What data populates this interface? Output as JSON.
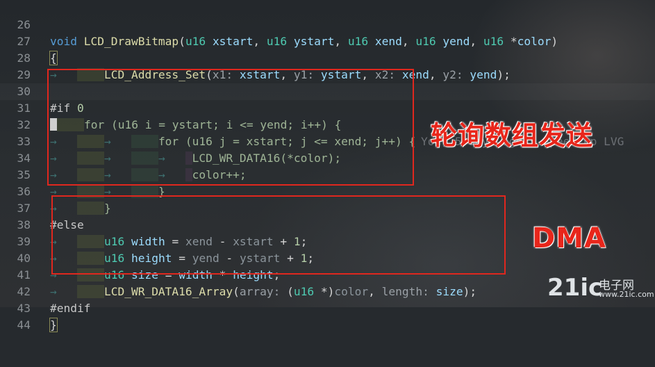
{
  "editor": {
    "lines": [
      {
        "n": "26"
      },
      {
        "n": "27"
      },
      {
        "n": "28"
      },
      {
        "n": "29"
      },
      {
        "n": "30"
      },
      {
        "n": "31"
      },
      {
        "n": "32"
      },
      {
        "n": "33"
      },
      {
        "n": "34"
      },
      {
        "n": "35"
      },
      {
        "n": "36"
      },
      {
        "n": "37"
      },
      {
        "n": "38"
      },
      {
        "n": "39"
      },
      {
        "n": "40"
      },
      {
        "n": "41"
      },
      {
        "n": "42"
      },
      {
        "n": "43"
      },
      {
        "n": "44"
      }
    ],
    "blame": "You, 5 days ago • Speed up LVG"
  },
  "annotations": {
    "polling": "轮询数组发送",
    "dma": "DMA"
  },
  "watermark": {
    "brand": "21ic",
    "cn": "电子网",
    "url": "www.21ic.com"
  },
  "colors": {
    "box_red": "#e0271e",
    "annotation_red": "#e8261b",
    "background": "#262a2e"
  }
}
